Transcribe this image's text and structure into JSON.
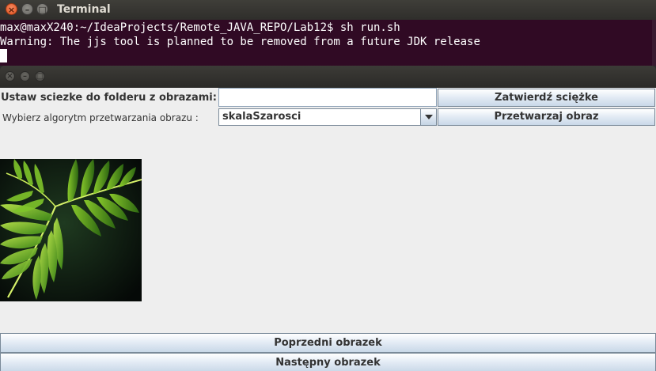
{
  "terminal": {
    "title": "Terminal",
    "close_glyph": "×",
    "min_glyph": "–",
    "max_glyph": "□",
    "lines": [
      "max@maxX240:~/IdeaProjects/Remote_JAVA_REPO/Lab12$ sh run.sh",
      "Warning: The jjs tool is planned to be removed from a future JDK release"
    ]
  },
  "app": {
    "window_buttons": {
      "close_glyph": "×",
      "min_glyph": "–",
      "max_glyph": "□"
    },
    "path_label": "Ustaw sciezke do folderu z obrazami:",
    "path_value": "",
    "confirm_button": "Zatwierdź sciężke",
    "algo_label": "Wybierz algorytm przetwarzania obrazu :",
    "algo_selected": "skalaSzarosci",
    "process_button": "Przetwarzaj obraz",
    "prev_button": "Poprzedni obrazek",
    "next_button": "Następny obrazek",
    "image_subject": "fern-leaf"
  },
  "colors": {
    "terminal_bg": "#300a24",
    "close_button": "#e95420",
    "button_gradient_top": "#ffffff",
    "button_gradient_bottom": "#c9d8e8",
    "panel_bg": "#eeeeee"
  },
  "icons": [
    "close-icon",
    "minimize-icon",
    "maximize-icon",
    "dropdown-arrow-icon"
  ]
}
